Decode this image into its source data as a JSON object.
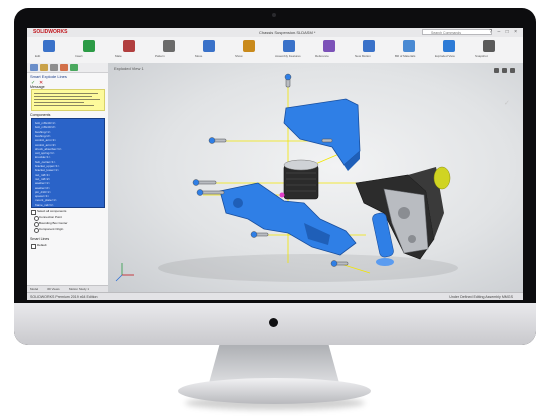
{
  "app": {
    "logo_text": "SOLIDWORKS",
    "document_title": "Chassis Suspension.SLDASM *",
    "search_placeholder": "Search Commands",
    "window_controls": "? – □ ×"
  },
  "ribbon": {
    "buttons": [
      {
        "label": "Edit",
        "color": "#3a72c9"
      },
      {
        "label": "Insert",
        "color": "#2c9b46"
      },
      {
        "label": "Mate",
        "color": "#b13f3f"
      },
      {
        "label": "Pattern",
        "color": "#6b6b6b"
      },
      {
        "label": "Move",
        "color": "#3a72c9"
      },
      {
        "label": "Show",
        "color": "#c98a1c"
      },
      {
        "label": "Assembly Features",
        "color": "#3a72c9"
      },
      {
        "label": "Reference",
        "color": "#7c52b8"
      },
      {
        "label": "New Motion",
        "color": "#3a72c9"
      },
      {
        "label": "Bill of Materials",
        "color": "#4a8ad3"
      },
      {
        "label": "Exploded View",
        "color": "#2d7bd6"
      },
      {
        "label": "Snapshot",
        "color": "#5a5a5a"
      }
    ]
  },
  "property_manager": {
    "title": "Smart Explode Lines",
    "ok_symbol": "✓",
    "cancel_symbol": "✕",
    "message_heading": "Message",
    "components_heading": "Components",
    "components": [
      "bolt_m8x40<1>",
      "bolt_m8x40<2>",
      "bushing<1>",
      "bushing<2>",
      "control_arm<1>",
      "control_arm<2>",
      "shock_absorber<1>",
      "coil_spring<1>",
      "knuckle<1>",
      "hub_carrier<1>",
      "bracket_upper<1>",
      "bracket_lower<1>",
      "nut_m8<1>",
      "nut_m8<2>",
      "washer<1>",
      "washer<2>",
      "pin_d10<1>",
      "spacer<1>",
      "mount_plate<1>",
      "frame_rail<1>"
    ],
    "options": [
      "Select all components",
      "Connection Point",
      "Bounding Box Center",
      "Component Origin"
    ],
    "appearance_heading": "Smart Lines",
    "appearance_value": "Default",
    "bottom_tabs": [
      "Model",
      "3D Views",
      "Motion Study 1"
    ]
  },
  "viewport": {
    "breadcrumb": "Exploded View 1",
    "colors": {
      "part_blue": "#2f7fe6",
      "part_dark": "#2a2a2a",
      "metal": "#b9bcc1",
      "explode_line": "#f2e600",
      "accent": "#d0d422"
    }
  },
  "status": {
    "left": "SOLIDWORKS Premium 2019 x64 Edition",
    "right": "Under Defined   Editing Assembly   MMGS"
  }
}
